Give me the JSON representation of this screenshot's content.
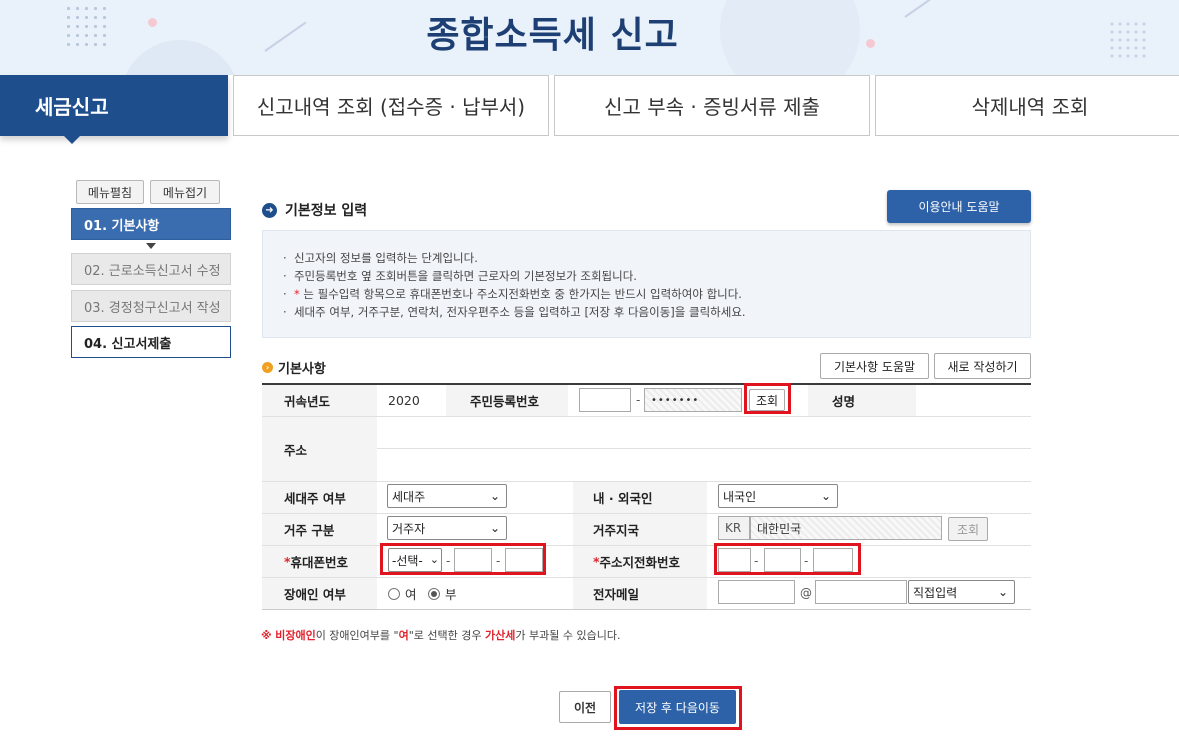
{
  "header": {
    "title": "종합소득세 신고"
  },
  "tabs": [
    {
      "label": "세금신고"
    },
    {
      "label": "신고내역 조회 (접수증 · 납부서)"
    },
    {
      "label": "신고 부속 · 증빙서류 제출"
    },
    {
      "label": "삭제내역 조회"
    }
  ],
  "sidebar": {
    "expand_label": "메뉴펼침",
    "collapse_label": "메뉴접기",
    "steps": [
      {
        "label": "01. 기본사항"
      },
      {
        "label": "02. 근로소득신고서 수정"
      },
      {
        "label": "03. 경정청구신고서 작성"
      },
      {
        "label": "04. 신고서제출"
      }
    ]
  },
  "main": {
    "section_title": "기본정보 입력",
    "help_button": "이용안내 도움말",
    "info": [
      "신고자의 정보를 입력하는 단계입니다.",
      "주민등록번호 옆 조회버튼을 클릭하면 근로자의 기본정보가 조회됩니다.",
      "는 필수입력 항목으로 휴대폰번호나 주소지전화번호 중 한가지는 반드시 입력하여야 합니다.",
      "세대주 여부, 거주구분, 연락처, 전자우편주소 등을 입력하고 [저장 후 다음이동]을 클릭하세요."
    ],
    "info_bullet": "·",
    "info_star": "*",
    "subsection_title": "기본사항",
    "basic_help_button": "기본사항 도움말",
    "new_write_button": "새로 작성하기",
    "form": {
      "year_label": "귀속년도",
      "year_value": "2020",
      "rrn_label": "주민등록번호",
      "rrn_front": "",
      "rrn_back": "•••••••",
      "rrn_lookup_button": "조회",
      "name_label": "성명",
      "address_label": "주소",
      "household_label": "세대주 여부",
      "household_value": "세대주",
      "nationality_label": "내 · 외국인",
      "nationality_value": "내국인",
      "residence_label": "거주 구분",
      "residence_value": "거주자",
      "country_label": "거주지국",
      "country_code": "KR",
      "country_name": "대한민국",
      "country_lookup_button": "조회",
      "mobile_label": "휴대폰번호",
      "mobile_select": "-선택-",
      "phone_label": "주소지전화번호",
      "disabled_label": "장애인 여부",
      "disabled_yes": "여",
      "disabled_no": "부",
      "email_label": "전자메일",
      "email_at": "@",
      "email_domain_select": "직접입력"
    },
    "note": {
      "prefix": "※",
      "part1": "비장애인",
      "part2": "이 장애인여부를 \"",
      "part3": "여",
      "part4": "\"로 선택한 경우 ",
      "part5": "가산세",
      "part6": "가 부과될 수 있습니다."
    },
    "prev_button": "이전",
    "next_button": "저장 후 다음이동"
  }
}
